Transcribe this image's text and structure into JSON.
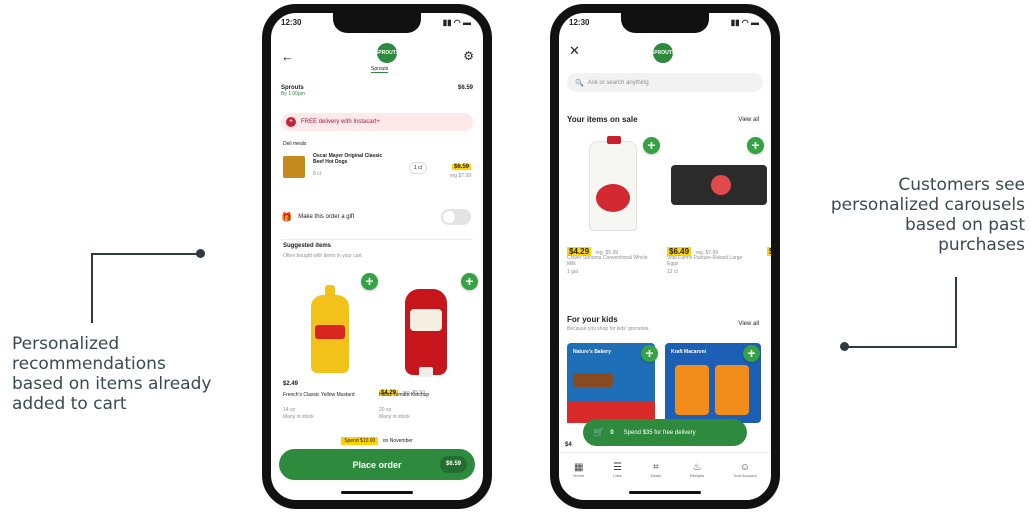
{
  "callouts": {
    "left": "Personalized recommendations based on items already added to cart",
    "right": "Customers see personalized carousels based on past purchases"
  },
  "icons": {
    "back": "arrow-left-icon",
    "settings": "gear-icon",
    "close": "close-icon",
    "search": "search-icon",
    "cart": "cart-icon",
    "gift": "gift-icon",
    "info": "info-icon"
  },
  "colors": {
    "brand": "#2e8b3d",
    "sale": "#ffd400"
  },
  "phone1": {
    "time": "12:30",
    "logo_text": "SPROUTS",
    "logo_caption": "Sprouts",
    "store_name": "Sprouts",
    "store_sub": "By 1:00pm",
    "store_total": "$6.59",
    "promo": "FREE delivery with Instacart+",
    "section_deli": "Deli meals",
    "cart_item": {
      "name": "Oscar Mayer Original Classic Beef Hot Dogs",
      "sub": "8 ct",
      "qty": "1 ct",
      "price": "$6.59",
      "old_price": "reg $7.99"
    },
    "gift_label": "Make this order a gift",
    "suggested_title": "Suggested items",
    "suggested_sub": "Often bought with items in your cart",
    "products": [
      {
        "price": "$2.49",
        "reg": "",
        "name": "French's Classic Yellow Mustard",
        "size": "14 oz",
        "note": "Many in stock"
      },
      {
        "price": "$4.29",
        "reg": "reg. $5.59",
        "name": "Heinz Tomato Ketchup",
        "size": "20 oz",
        "note": "Many in stock"
      }
    ],
    "spend_tag": "Spend $10.00",
    "spend_rest": "on November",
    "place_order": "Place order",
    "order_total": "$6.59"
  },
  "phone2": {
    "time": "12:30",
    "logo_text": "SPROUTS",
    "search_placeholder": "Ask or search anything",
    "sale_title": "Your items on sale",
    "sale_view_all": "View all",
    "sale_items": [
      {
        "price": "$4.29",
        "reg": "reg. $5.99",
        "name": "Clover Sonoma Conventional Whole Milk",
        "size": "1 gal"
      },
      {
        "price": "$6.49",
        "reg": "reg. $7.99",
        "name": "Vital Farms Pasture-Raised Large Eggs",
        "size": "12 ct"
      },
      {
        "price": "$",
        "reg": "",
        "name": "",
        "size": ""
      }
    ],
    "kids_title": "For your kids",
    "kids_sub": "Because you shop for kids' groceries",
    "kids_view_all": "View all",
    "kids_items": [
      {
        "label": "Nature's Bakery"
      },
      {
        "label": "Kraft Macaroni"
      }
    ],
    "cart_count": "0",
    "cart_msg": "Spend $35 for free delivery",
    "partial_price": "$4",
    "nav": [
      "Home",
      "Lists",
      "Deals",
      "Recipes",
      "Your Account"
    ]
  }
}
